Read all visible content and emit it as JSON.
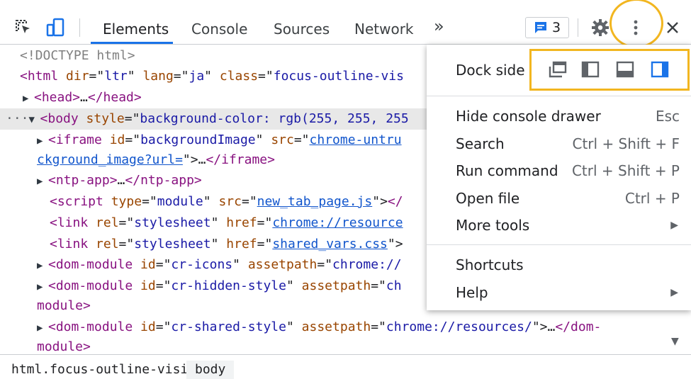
{
  "toolbar": {
    "tabs": [
      {
        "label": "Elements",
        "active": true
      },
      {
        "label": "Console"
      },
      {
        "label": "Sources"
      },
      {
        "label": "Network"
      }
    ],
    "more_tabs": "»",
    "issues_count": "3",
    "icons": [
      "inspect-element-icon",
      "device-toggle-icon",
      "message-icon",
      "gear-icon",
      "kebab-menu-icon",
      "close-icon"
    ]
  },
  "code_lines": [
    {
      "parts": [
        [
          "g",
          "<!DOCTYPE html>"
        ]
      ]
    },
    {
      "parts": [
        [
          "t",
          "<html "
        ],
        [
          "a",
          "dir"
        ],
        [
          "k",
          "=\""
        ],
        [
          "v",
          "ltr"
        ],
        [
          "k",
          "\" "
        ],
        [
          "a",
          "lang"
        ],
        [
          "k",
          "=\""
        ],
        [
          "v",
          "ja"
        ],
        [
          "k",
          "\" "
        ],
        [
          "a",
          "class"
        ],
        [
          "k",
          "=\""
        ],
        [
          "v",
          "focus-outline-vis"
        ]
      ]
    },
    {
      "tri": "▶",
      "parts": [
        [
          "t",
          "<head>"
        ],
        [
          "k",
          "…"
        ],
        [
          "t",
          "</head>"
        ]
      ]
    },
    {
      "tri": "▼",
      "dots": "···",
      "selected": true,
      "parts": [
        [
          "t",
          "<body "
        ],
        [
          "a",
          "style"
        ],
        [
          "k",
          "=\""
        ],
        [
          "v",
          "background-color: rgb(255, 255, 255"
        ]
      ]
    },
    {
      "tri": "▶",
      "parts": [
        [
          "t",
          "<iframe "
        ],
        [
          "a",
          "id"
        ],
        [
          "k",
          "=\""
        ],
        [
          "v",
          "backgroundImage"
        ],
        [
          "k",
          "\" "
        ],
        [
          "a",
          "src"
        ],
        [
          "k",
          "=\""
        ],
        [
          "l",
          "chrome-untru"
        ]
      ]
    },
    {
      "parts": [
        [
          "l",
          "ckground_image?url="
        ],
        [
          "k",
          "\">"
        ],
        [
          "k",
          "…"
        ],
        [
          "t",
          "</iframe>"
        ]
      ]
    },
    {
      "tri": "▶",
      "parts": [
        [
          "t",
          "<ntp-app>"
        ],
        [
          "k",
          "…"
        ],
        [
          "t",
          "</ntp-app>"
        ]
      ]
    },
    {
      "parts": [
        [
          "t",
          "<script "
        ],
        [
          "a",
          "type"
        ],
        [
          "k",
          "=\""
        ],
        [
          "v",
          "module"
        ],
        [
          "k",
          "\" "
        ],
        [
          "a",
          "src"
        ],
        [
          "k",
          "=\""
        ],
        [
          "l",
          "new_tab_page.js"
        ],
        [
          "k",
          "\">"
        ],
        [
          "t",
          "</"
        ]
      ]
    },
    {
      "parts": [
        [
          "t",
          "<link "
        ],
        [
          "a",
          "rel"
        ],
        [
          "k",
          "=\""
        ],
        [
          "v",
          "stylesheet"
        ],
        [
          "k",
          "\" "
        ],
        [
          "a",
          "href"
        ],
        [
          "k",
          "=\""
        ],
        [
          "l",
          "chrome://resource"
        ]
      ]
    },
    {
      "parts": [
        [
          "t",
          "<link "
        ],
        [
          "a",
          "rel"
        ],
        [
          "k",
          "=\""
        ],
        [
          "v",
          "stylesheet"
        ],
        [
          "k",
          "\" "
        ],
        [
          "a",
          "href"
        ],
        [
          "k",
          "=\""
        ],
        [
          "l",
          "shared_vars.css"
        ],
        [
          "k",
          "\">"
        ]
      ]
    },
    {
      "tri": "▶",
      "parts": [
        [
          "t",
          "<dom-module "
        ],
        [
          "a",
          "id"
        ],
        [
          "k",
          "=\""
        ],
        [
          "v",
          "cr-icons"
        ],
        [
          "k",
          "\" "
        ],
        [
          "a",
          "assetpath"
        ],
        [
          "k",
          "=\""
        ],
        [
          "v",
          "chrome://"
        ]
      ]
    },
    {
      "tri": "▶",
      "parts": [
        [
          "t",
          "<dom-module "
        ],
        [
          "a",
          "id"
        ],
        [
          "k",
          "=\""
        ],
        [
          "v",
          "cr-hidden-style"
        ],
        [
          "k",
          "\" "
        ],
        [
          "a",
          "assetpath"
        ],
        [
          "k",
          "=\""
        ],
        [
          "v",
          "ch"
        ]
      ]
    },
    {
      "parts": [
        [
          "t",
          "module>"
        ]
      ]
    },
    {
      "tri": "▶",
      "parts": [
        [
          "t",
          "<dom-module "
        ],
        [
          "a",
          "id"
        ],
        [
          "k",
          "=\""
        ],
        [
          "v",
          "cr-shared-style"
        ],
        [
          "k",
          "\" "
        ],
        [
          "a",
          "assetpath"
        ],
        [
          "k",
          "=\""
        ],
        [
          "v",
          "chrome://resources/"
        ],
        [
          "k",
          "\">"
        ],
        [
          "k",
          "…"
        ],
        [
          "t",
          "</dom-"
        ]
      ]
    },
    {
      "parts": [
        [
          "t",
          "module>"
        ]
      ]
    }
  ],
  "breadcrumbs": [
    {
      "label": "html.focus-outline-visible"
    },
    {
      "label": "body",
      "active": true
    }
  ],
  "menu": {
    "dock_side_label": "Dock side",
    "dock_options": [
      "undock-icon",
      "dock-left-icon",
      "dock-bottom-icon",
      "dock-right-icon"
    ],
    "items": [
      {
        "label": "Hide console drawer",
        "shortcut": "Esc"
      },
      {
        "label": "Search",
        "shortcut": "Ctrl + Shift + F"
      },
      {
        "label": "Run command",
        "shortcut": "Ctrl + Shift + P"
      },
      {
        "label": "Open file",
        "shortcut": "Ctrl + P"
      },
      {
        "label": "More tools",
        "submenu": true
      }
    ],
    "items2": [
      {
        "label": "Shortcuts"
      },
      {
        "label": "Help",
        "submenu": true
      }
    ]
  },
  "colors": {
    "accent": "#1a73e8",
    "highlight": "#f2b620"
  }
}
